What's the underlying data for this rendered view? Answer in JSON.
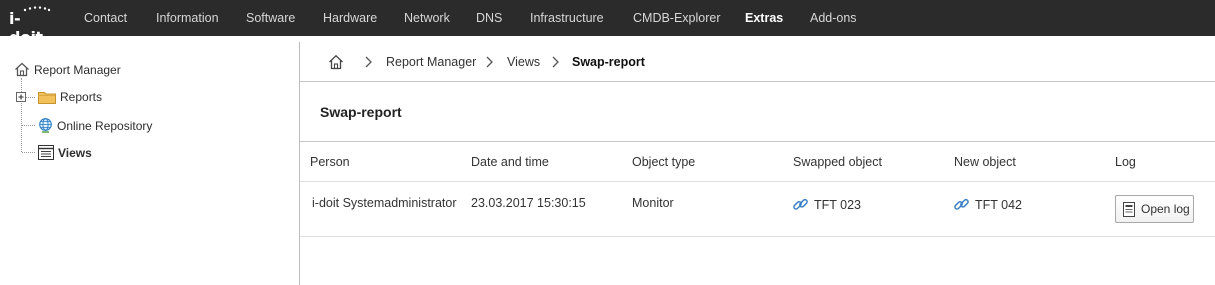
{
  "app": {
    "logo": "i-doit"
  },
  "nav": {
    "items": [
      "Contact",
      "Information",
      "Software",
      "Hardware",
      "Network",
      "DNS",
      "Infrastructure",
      "CMDB-Explorer",
      "Extras",
      "Add-ons"
    ],
    "active": "Extras"
  },
  "tree": {
    "root": "Report Manager",
    "items": [
      "Reports",
      "Online Repository",
      "Views"
    ],
    "selected": "Views"
  },
  "breadcrumb": {
    "items": [
      "Report Manager",
      "Views",
      "Swap-report"
    ]
  },
  "page": {
    "title": "Swap-report"
  },
  "table": {
    "columns": [
      "Person",
      "Date and time",
      "Object type",
      "Swapped object",
      "New object",
      "Log"
    ],
    "rows": [
      {
        "person": "i-doit Systemadministrator",
        "datetime": "23.03.2017 15:30:15",
        "object_type": "Monitor",
        "swapped_object": "TFT 023",
        "new_object": "TFT 042",
        "log_button": "Open log"
      }
    ]
  },
  "colors": {
    "topbar_bg": "#2b2b2b",
    "link_icon": "#3a7fc4",
    "folder": "#f2c15b"
  }
}
